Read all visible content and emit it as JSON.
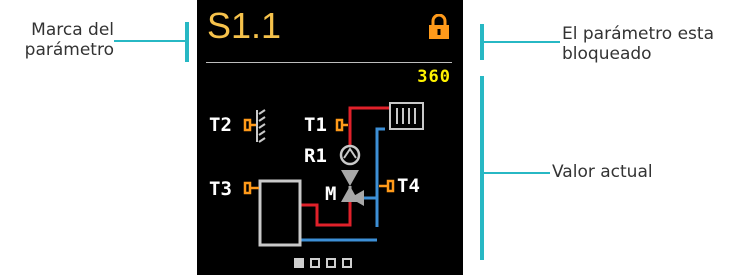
{
  "callouts": {
    "param_mark": {
      "lines": [
        "Marca del",
        "parámetro"
      ]
    },
    "locked": {
      "lines": [
        "El parámetro esta",
        "bloqueado"
      ]
    },
    "current_value": {
      "lines": [
        "Valor actual"
      ]
    }
  },
  "screen": {
    "param_mark": "S1.1",
    "current_value": "360",
    "sensors": {
      "t1": "T1",
      "t2": "T2",
      "t3": "T3",
      "t4": "T4",
      "r1": "R1",
      "m": "M"
    },
    "pages": {
      "current": 1,
      "total": 4
    }
  },
  "colors": {
    "accent": "#27b8c4",
    "mark": "#f6c24b",
    "lock": "#ff9a1a",
    "value": "#fff200",
    "hot_pipe": "#e0212a",
    "cold_pipe": "#3d8fd6",
    "sensor_marker": "#ff9a1a"
  },
  "icons": [
    "lock-icon",
    "radiator-icon",
    "pump-icon",
    "mixing-valve-icon",
    "storage-tank-icon",
    "heat-source-icon"
  ]
}
